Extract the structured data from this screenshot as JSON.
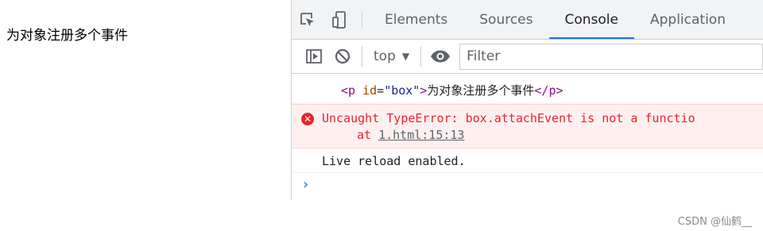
{
  "page": {
    "text": "为对象注册多个事件"
  },
  "devtools": {
    "tabs": [
      {
        "label": "Elements",
        "active": false
      },
      {
        "label": "Sources",
        "active": false
      },
      {
        "label": "Console",
        "active": true
      },
      {
        "label": "Application",
        "active": false
      }
    ],
    "toolbar": {
      "context": "top",
      "filter_placeholder": "Filter"
    },
    "console": {
      "html_open_tag": "<p",
      "html_attr_name": " id",
      "html_attr_eq": "=",
      "html_attr_value": "\"box\"",
      "html_tag_close": ">",
      "html_text": "为对象注册多个事件",
      "html_end_tag": "</p>",
      "error_message": "Uncaught TypeError: box.attachEvent is not a functio",
      "error_at": "at ",
      "error_link": "1.html:15:13",
      "log_message": "Live reload enabled.",
      "prompt": "›"
    },
    "colors": {
      "accent": "#1a73e8",
      "error": "#e8242f",
      "error_bg": "#fff0f0"
    }
  },
  "watermark": "CSDN @仙鹤__"
}
